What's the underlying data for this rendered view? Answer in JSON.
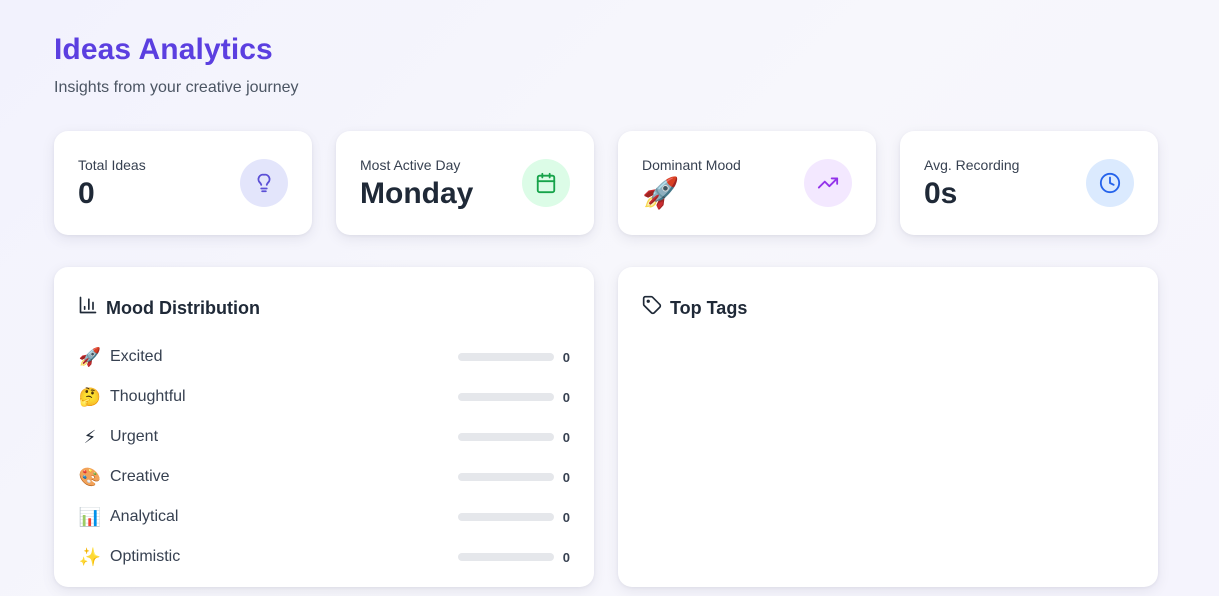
{
  "header": {
    "title": "Ideas Analytics",
    "subtitle": "Insights from your creative journey"
  },
  "stats": [
    {
      "label": "Total Ideas",
      "value": "0",
      "icon": "lightbulb-icon",
      "icon_bg": "#e3e5fb",
      "icon_color": "#5b4fd6"
    },
    {
      "label": "Most Active Day",
      "value": "Monday",
      "icon": "calendar-icon",
      "icon_bg": "#dcfce7",
      "icon_color": "#16a34a"
    },
    {
      "label": "Dominant Mood",
      "value": "🚀",
      "icon": "trending-up-icon",
      "icon_bg": "#f3e8ff",
      "icon_color": "#9333ea"
    },
    {
      "label": "Avg. Recording",
      "value": "0s",
      "icon": "clock-icon",
      "icon_bg": "#dbeafe",
      "icon_color": "#2563eb"
    }
  ],
  "mood_distribution": {
    "title": "Mood Distribution",
    "icon": "bar-chart-icon",
    "bar_color": "#6d4ae8",
    "track_color": "#e5e7eb",
    "moods": [
      {
        "emoji": "🚀",
        "name": "Excited",
        "count": "0",
        "fraction": 0
      },
      {
        "emoji": "🤔",
        "name": "Thoughtful",
        "count": "0",
        "fraction": 0
      },
      {
        "emoji": "⚡",
        "name": "Urgent",
        "count": "0",
        "fraction": 0
      },
      {
        "emoji": "🎨",
        "name": "Creative",
        "count": "0",
        "fraction": 0
      },
      {
        "emoji": "📊",
        "name": "Analytical",
        "count": "0",
        "fraction": 0
      },
      {
        "emoji": "✨",
        "name": "Optimistic",
        "count": "0",
        "fraction": 0
      }
    ]
  },
  "top_tags": {
    "title": "Top Tags",
    "icon": "tag-icon",
    "tags": []
  },
  "colors": {
    "accent": "#5b3fe0",
    "text": "#1f2937",
    "muted": "#4b5563"
  }
}
